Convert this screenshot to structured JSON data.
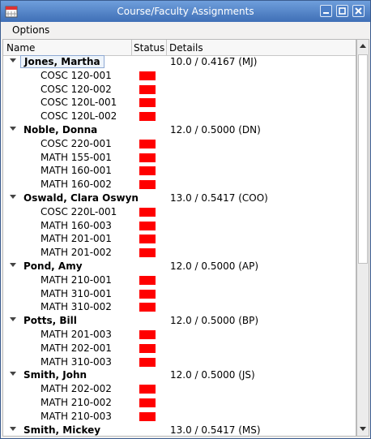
{
  "window": {
    "title": "Course/Faculty Assignments"
  },
  "menu": {
    "options": "Options"
  },
  "columns": {
    "name": "Name",
    "status": "Status",
    "details": "Details"
  },
  "status_color": "#ff0000",
  "faculty": [
    {
      "name": "Jones, Martha",
      "details": "10.0 / 0.4167  (MJ)",
      "courses": [
        "COSC 120-001",
        "COSC 120-002",
        "COSC 120L-001",
        "COSC 120L-002"
      ]
    },
    {
      "name": "Noble, Donna",
      "details": "12.0 / 0.5000  (DN)",
      "courses": [
        "COSC 220-001",
        "MATH 155-001",
        "MATH 160-001",
        "MATH 160-002"
      ]
    },
    {
      "name": "Oswald, Clara Oswyn",
      "details": "13.0 / 0.5417  (COO)",
      "courses": [
        "COSC 220L-001",
        "MATH 160-003",
        "MATH 201-001",
        "MATH 201-002"
      ]
    },
    {
      "name": "Pond, Amy",
      "details": "12.0 / 0.5000  (AP)",
      "courses": [
        "MATH 210-001",
        "MATH 310-001",
        "MATH 310-002"
      ]
    },
    {
      "name": "Potts, Bill",
      "details": "12.0 / 0.5000  (BP)",
      "courses": [
        "MATH 201-003",
        "MATH 202-001",
        "MATH 310-003"
      ]
    },
    {
      "name": "Smith, John",
      "details": "12.0 / 0.5000  (JS)",
      "courses": [
        "MATH 202-002",
        "MATH 210-002",
        "MATH 210-003"
      ]
    },
    {
      "name": "Smith, Mickey",
      "details": "13.0 / 0.5417  (MS)",
      "courses": []
    }
  ]
}
